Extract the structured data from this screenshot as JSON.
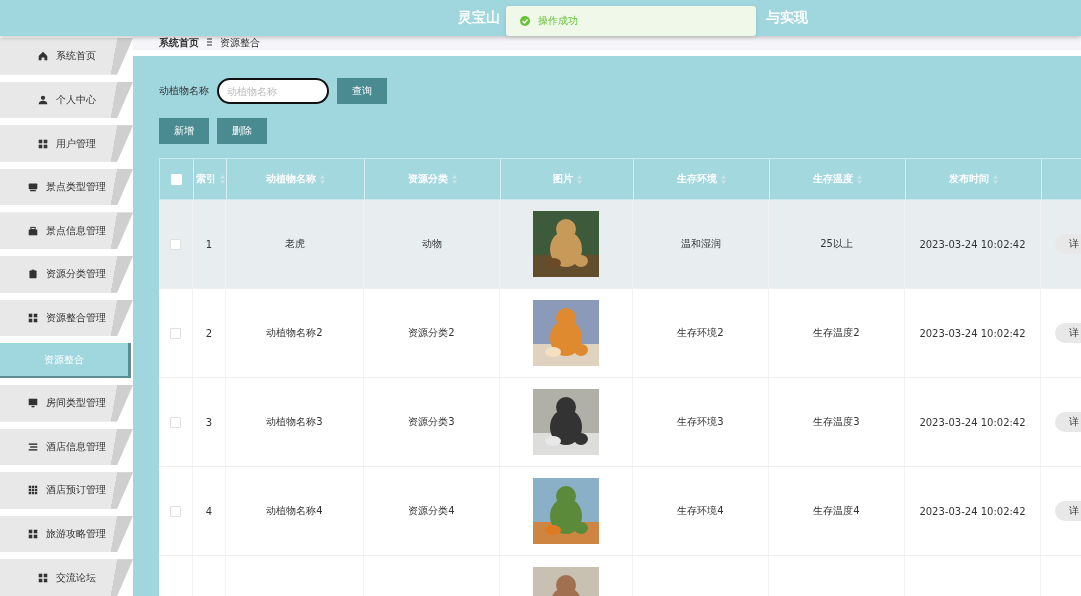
{
  "header": {
    "title_start": "灵宝山",
    "title_end": "与实现"
  },
  "toast": {
    "message": "操作成功"
  },
  "sidebar": {
    "items": [
      {
        "label": "系统首页",
        "selected": false
      },
      {
        "label": "个人中心",
        "selected": false
      },
      {
        "label": "用户管理",
        "selected": false
      },
      {
        "label": "景点类型管理",
        "selected": false
      },
      {
        "label": "景点信息管理",
        "selected": false
      },
      {
        "label": "资源分类管理",
        "selected": false
      },
      {
        "label": "资源整合管理",
        "selected": false,
        "children": [
          {
            "label": "资源整合",
            "selected": true
          }
        ]
      },
      {
        "label": "房间类型管理",
        "selected": false
      },
      {
        "label": "酒店信息管理",
        "selected": false
      },
      {
        "label": "酒店预订管理",
        "selected": false
      },
      {
        "label": "旅游攻略管理",
        "selected": false
      },
      {
        "label": "交流论坛",
        "selected": false
      }
    ]
  },
  "breadcrumb": [
    "系统首页",
    "资源整合"
  ],
  "search": {
    "label": "动植物名称",
    "placeholder": "动植物名称",
    "button": "查询"
  },
  "actions": [
    "新增",
    "删除"
  ],
  "table": {
    "header_checked": false,
    "columns": [
      "索引",
      "动植物名称",
      "资源分类",
      "图片",
      "生存环境",
      "生存温度",
      "发布时间"
    ],
    "rows": [
      {
        "checked": false,
        "hovered": true,
        "index": "1",
        "name": "老虎",
        "category": "动物",
        "environment": "温和湿润",
        "temperature": "25以上",
        "time": "2023-03-24 10:02:42",
        "action": "详"
      },
      {
        "checked": false,
        "hovered": false,
        "index": "2",
        "name": "动植物名称2",
        "category": "资源分类2",
        "environment": "生存环境2",
        "temperature": "生存温度2",
        "time": "2023-03-24 10:02:42",
        "action": "详"
      },
      {
        "checked": false,
        "hovered": false,
        "index": "3",
        "name": "动植物名称3",
        "category": "资源分类3",
        "environment": "生存环境3",
        "temperature": "生存温度3",
        "time": "2023-03-24 10:02:42",
        "action": "详"
      },
      {
        "checked": false,
        "hovered": false,
        "index": "4",
        "name": "动植物名称4",
        "category": "资源分类4",
        "environment": "生存环境4",
        "temperature": "生存温度4",
        "time": "2023-03-24 10:02:42",
        "action": "详"
      },
      {
        "hovered": false
      }
    ]
  }
}
